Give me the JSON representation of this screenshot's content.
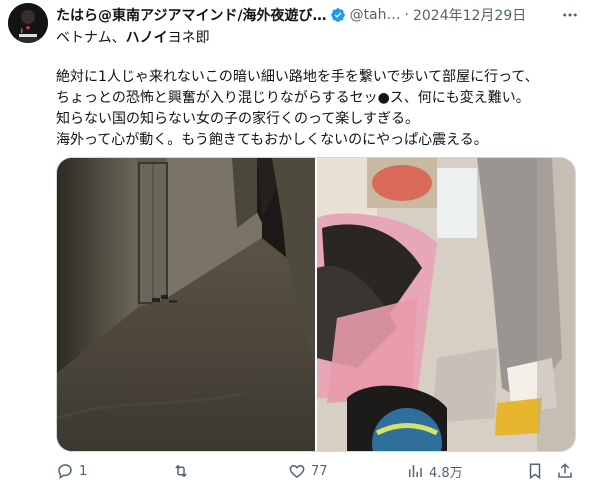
{
  "author": {
    "name": "たはら@東南アジアマインド/海外夜遊び…",
    "handle": "@tah…",
    "date": "2024年12月29日"
  },
  "subline": {
    "prefix": "ベトナム、",
    "bold": "ハノイ",
    "suffix": "ヨネ即"
  },
  "body_text": "絶対に1人じゃ来れないこの暗い細い路地を手を繋いで歩いて部屋に行って、\nちょっとの恐怖と興奮が入り混じりながらするセッ●ス、何にも変え難い。\n知らない国の知らない女の子の家行くのって楽しすぎる。\n海外って心が動く。もう飽きてもおかしくないのにやっぱ心震える。",
  "actions": {
    "replies": "1",
    "reposts": "",
    "likes": "77",
    "views": "4.8万"
  },
  "colors": {
    "text": "#0f1419",
    "muted": "#536471",
    "verified": "#1d9bf0",
    "border": "#cfd9de"
  },
  "icons": [
    "more-icon",
    "reply-icon",
    "repost-icon",
    "like-icon",
    "views-icon",
    "bookmark-icon",
    "share-icon",
    "verified-badge-icon"
  ]
}
